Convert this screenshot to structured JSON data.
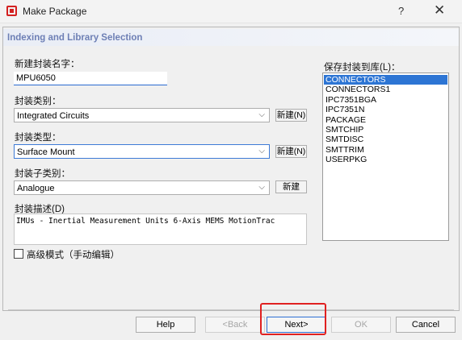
{
  "window": {
    "title": "Make Package",
    "help_glyph": "?",
    "close_glyph": "✕"
  },
  "header": {
    "title": "Indexing and Library Selection"
  },
  "form": {
    "name_label": "新建封装名字：",
    "name_value": "MPU6050",
    "category_label": "封装类别：",
    "category_value": "Integrated Circuits",
    "category_new": "新建(N)",
    "type_label": "封装类型：",
    "type_value": "Surface Mount",
    "type_new": "新建(N)",
    "subcategory_label": "封装子类别：",
    "subcategory_value": "Analogue",
    "subcategory_new": "新建",
    "description_label": "封装描述(D)",
    "description_value": "IMUs - Inertial Measurement Units 6-Axis MEMS MotionTrac",
    "advanced_label": "高级模式（手动编辑）"
  },
  "library": {
    "label": "保存封装到库(L)：",
    "items": [
      "CONNECTORS",
      "CONNECTORS1",
      "IPC7351BGA",
      "IPC7351N",
      "PACKAGE",
      "SMTCHIP",
      "SMTDISC",
      "SMTTRIM",
      "USERPKG"
    ],
    "selected": "CONNECTORS"
  },
  "buttons": {
    "help": "Help",
    "back": "<Back",
    "next": "Next>",
    "ok": "OK",
    "cancel": "Cancel"
  },
  "colors": {
    "accent": "#2d75d4",
    "header_text": "#6d7fb5",
    "highlight": "#e02020"
  }
}
